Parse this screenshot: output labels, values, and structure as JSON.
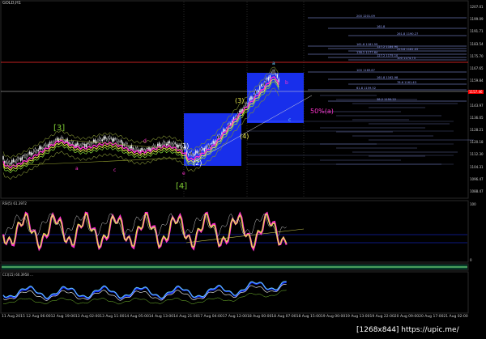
{
  "chart": {
    "symbol": "GOLD,H1",
    "background": "#000000",
    "wave_labels": {
      "major_3": "[3]",
      "major_4": "[4]",
      "minor_1": "(1)",
      "minor_2": "(2)",
      "minor_3": "(3)",
      "minor_4": "(4)",
      "micro_a": "a",
      "micro_b": "b",
      "micro_c": "c",
      "micro_d": "d",
      "micro_e": "e",
      "pct_label": "50%(a)"
    },
    "price_axis": [
      "1207.01",
      "1199.09",
      "1191.71",
      "1183.54",
      "1175.70",
      "1167.65",
      "1159.84",
      "1151.81",
      "1143.97",
      "1136.05",
      "1128.21",
      "1120.18",
      "1112.30",
      "1104.31",
      "1096.47",
      "1088.47"
    ],
    "current_price_badge": "1157.46",
    "current_price_badge_color": "#ff0000",
    "indicator_1": {
      "label": "RSI(5) 61.3972",
      "levels": [
        "100",
        "0"
      ]
    },
    "indicator_2": {
      "label": "CCI(15) 60.3958 ..."
    },
    "time_axis": [
      "11 Aug 2015",
      "12 Aug 06:00",
      "12 Aug 19:00",
      "13 Aug 02:00",
      "13 Aug 11:00",
      "14 Aug 05:00",
      "14 Aug 13:00",
      "14 Aug 21:00",
      "17 Aug 04:00",
      "17 Aug 12:00",
      "18 Aug 00:00",
      "18 Aug 07:00",
      "18 Aug 15:00",
      "19 Aug 00:00",
      "19 Aug 13:00",
      "19 Aug 22:00",
      "20 Aug 09:00",
      "20 Aug 17:00",
      "21 Aug 02:00"
    ],
    "watermark": "[1268x844] https://upic.me/",
    "fib_levels_right": [
      "200 1201.09",
      "161.8",
      "261.8 1190.27",
      "161.8 1181.59",
      "127.2 1184.90",
      "223.6 1181.05",
      "138.2 1177.64",
      "127.2 1175.10",
      "100 1174.73",
      "100 1169.67",
      "161.8 1162.98",
      "78.6 1161.43",
      "61.8 1159.52",
      "38.2 1150.22"
    ],
    "colors": {
      "blue_box": "#1a33ff",
      "fib_line": "#9aa8ff",
      "red_line": "#ff2a2a",
      "white_line": "#d8d8d8",
      "wave_green": "#7fcc33",
      "wave_yellow": "#e8e84a",
      "wave_magenta": "#ff33cc",
      "wave_cyan": "#66ccff"
    }
  }
}
